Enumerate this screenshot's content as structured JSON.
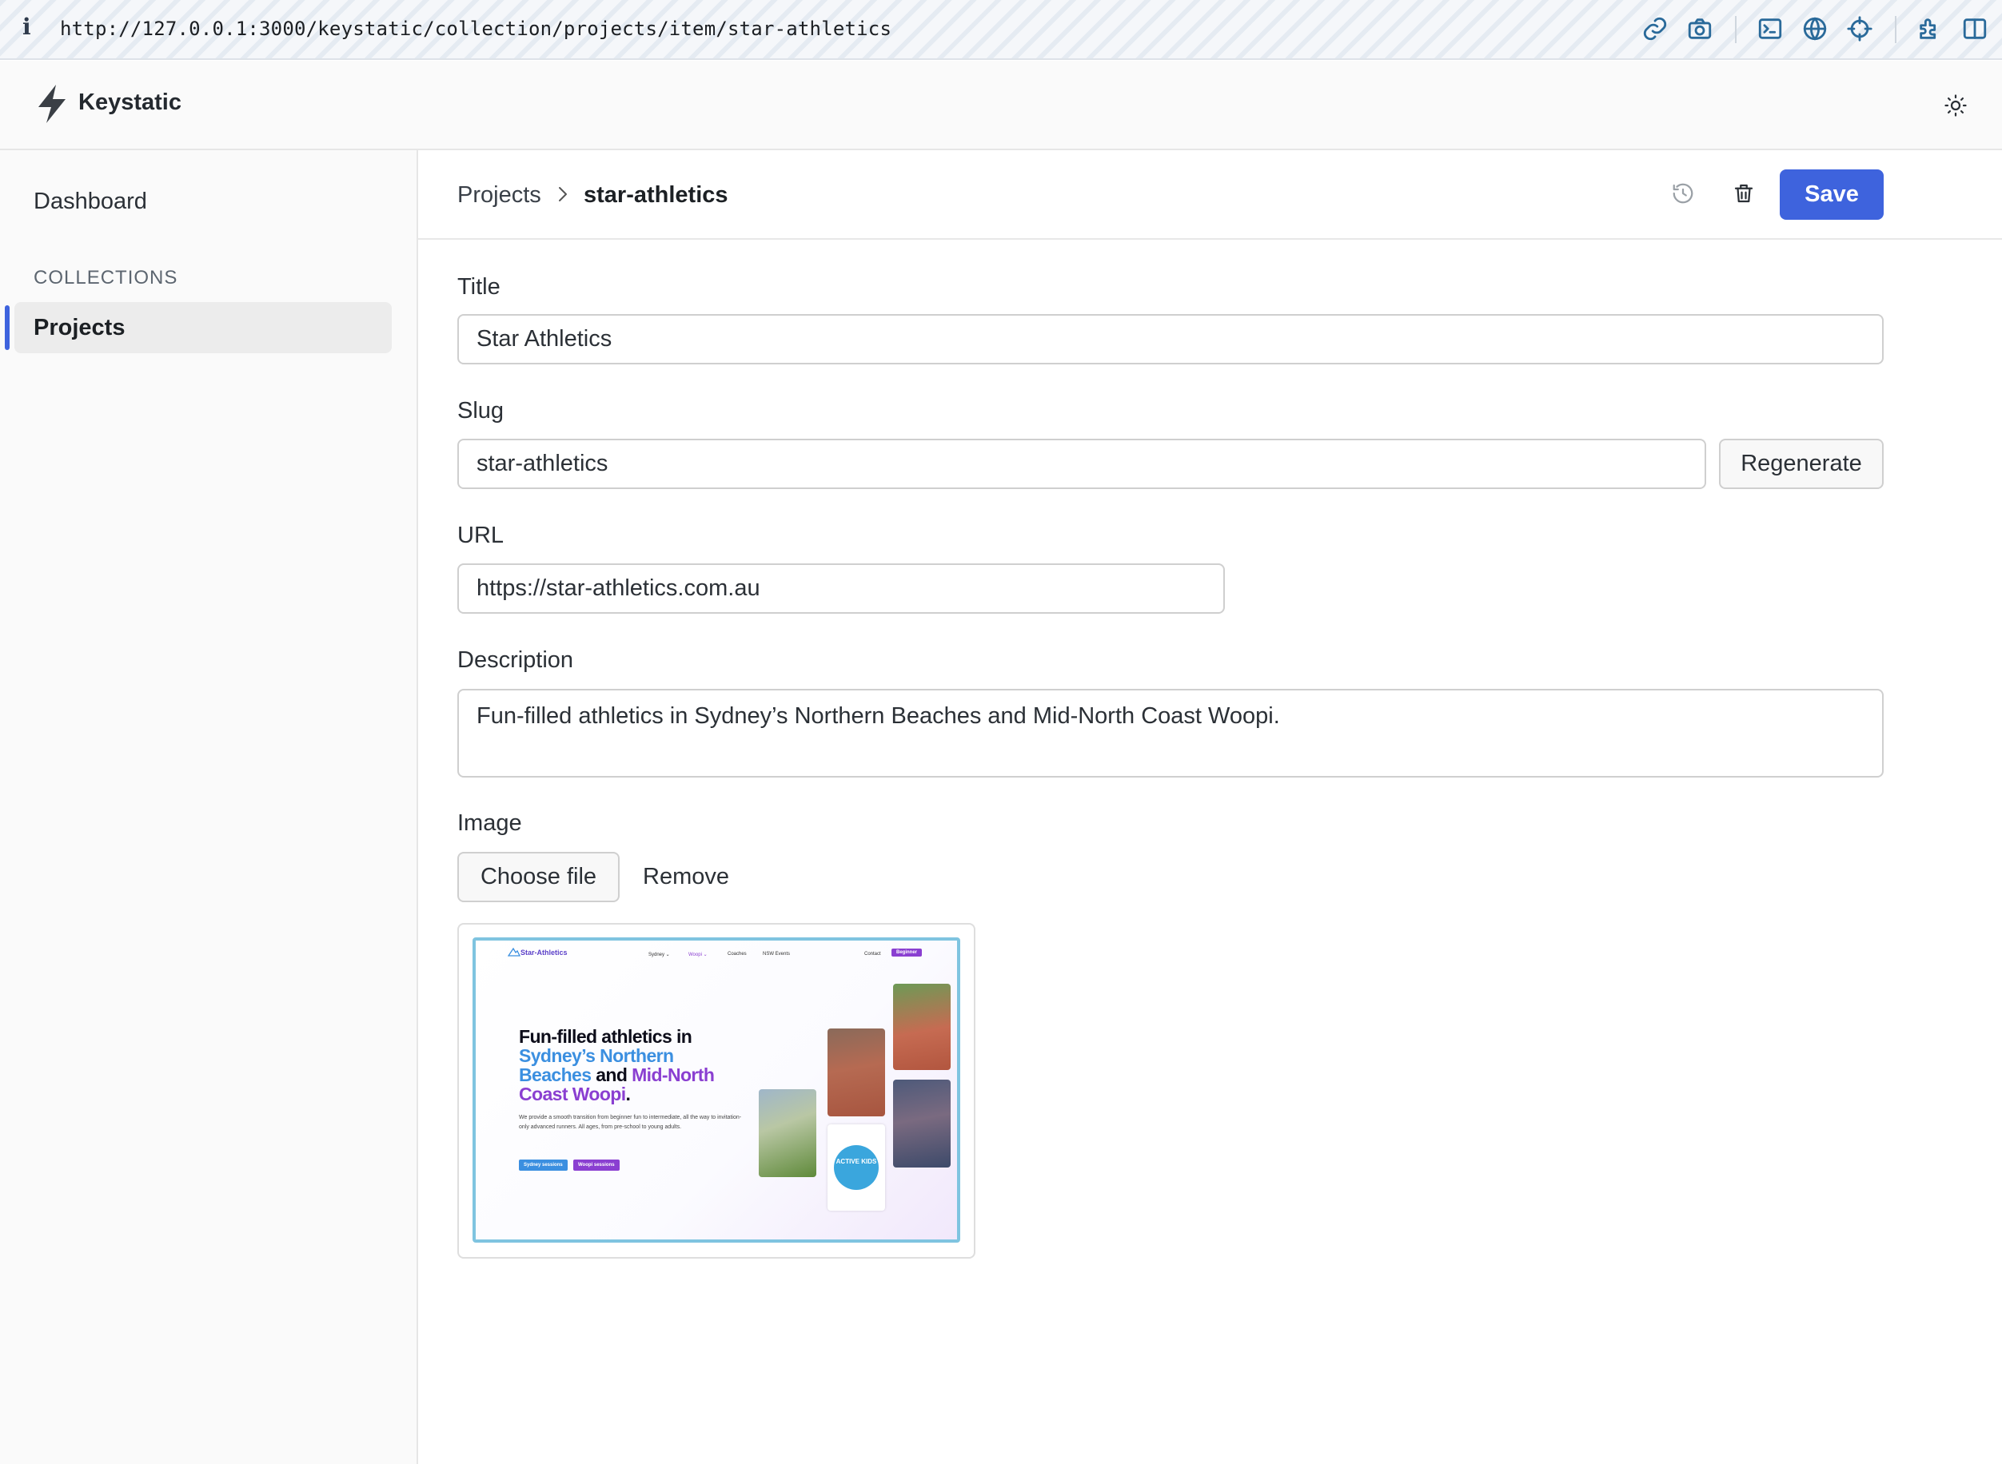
{
  "browser": {
    "url": "http://127.0.0.1:3000/keystatic/collection/projects/item/star-athletics",
    "info_icon": "i"
  },
  "app": {
    "name": "Keystatic"
  },
  "sidebar": {
    "dashboard_label": "Dashboard",
    "section_label": "COLLECTIONS",
    "items": [
      {
        "label": "Projects",
        "active": true
      }
    ]
  },
  "topbar": {
    "breadcrumb_parent": "Projects",
    "breadcrumb_current": "star-athletics",
    "save_label": "Save"
  },
  "form": {
    "title": {
      "label": "Title",
      "value": "Star Athletics"
    },
    "slug": {
      "label": "Slug",
      "value": "star-athletics",
      "regenerate_label": "Regenerate"
    },
    "url": {
      "label": "URL",
      "value": "https://star-athletics.com.au"
    },
    "description": {
      "label": "Description",
      "value": "Fun-filled athletics in Sydney’s Northern Beaches and Mid-North Coast Woopi."
    },
    "image": {
      "label": "Image",
      "choose_label": "Choose file",
      "remove_label": "Remove"
    }
  },
  "preview": {
    "logo": "Star-Athletics",
    "nav": [
      "Sydney ⌄",
      "Woopi ⌄",
      "Coaches",
      "NSW Events",
      "Contact"
    ],
    "nav_cta": "Beginner",
    "heading_line1": "Fun-filled athletics in",
    "heading_line2": "Sydney’s Northern",
    "heading_line3_a": "Beaches",
    "heading_line3_b": " and ",
    "heading_line3_c": "Mid-North",
    "heading_line4": "Coast Woopi",
    "heading_end": ".",
    "paragraph": "We provide a smooth transition from beginner fun to intermediate, all the way to invitation-only advanced runners. All ages, from pre-school to young adults.",
    "btn_sydney": "Sydney sessions",
    "btn_woopi": "Woopi sessions",
    "badge_text": "ACTIVE KIDS"
  },
  "colors": {
    "accent": "#3e63dd",
    "preview_blue": "#3b8fe0",
    "preview_purple": "#8a3fd1"
  },
  "icons": {
    "toolbar": [
      "link-icon",
      "camera-icon",
      "terminal-icon",
      "globe-icon",
      "crosshair-icon",
      "extension-icon",
      "sidebar-toggle-icon"
    ],
    "theme": "sun-icon",
    "history": "history-icon",
    "delete": "trash-icon"
  }
}
